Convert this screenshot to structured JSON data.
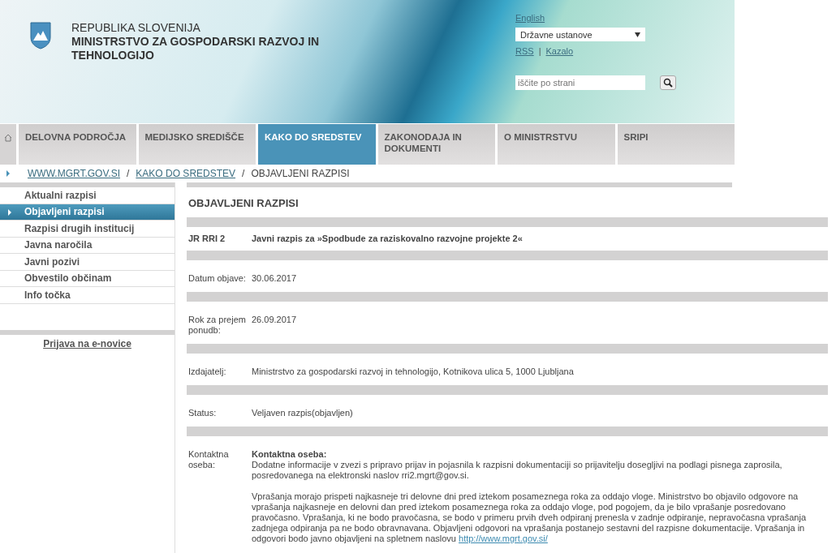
{
  "header": {
    "country": "REPUBLIKA SLOVENIJA",
    "ministry": "MINISTRSTVO ZA GOSPODARSKI RAZVOJ IN TEHNOLOGIJO",
    "language_link": "English",
    "institutions_select": "Državne ustanove",
    "links": [
      {
        "kind": "link",
        "label": "RSS"
      },
      {
        "kind": "separator",
        "label": "|"
      },
      {
        "kind": "link",
        "label": "Kazalo"
      }
    ],
    "search": {
      "placeholder": "iščite po strani"
    }
  },
  "nav": [
    {
      "label": "DELOVNA PODROČJA",
      "selected": false
    },
    {
      "label": "MEDIJSKO SREDIŠČE",
      "selected": false
    },
    {
      "label": "KAKO DO SREDSTEV",
      "selected": true
    },
    {
      "label": "ZAKONODAJA IN DOKUMENTI",
      "selected": false
    },
    {
      "label": "O MINISTRSTVU",
      "selected": false
    },
    {
      "label": "SRIPI",
      "selected": false
    }
  ],
  "breadcrumb": [
    {
      "kind": "link",
      "label": "WWW.MGRT.GOV.SI"
    },
    {
      "kind": "separator",
      "label": "/"
    },
    {
      "kind": "link",
      "label": "KAKO DO SREDSTEV"
    },
    {
      "kind": "separator",
      "label": "/"
    },
    {
      "kind": "current",
      "label": "OBJAVLJENI RAZPISI"
    }
  ],
  "sidebar": {
    "items": [
      {
        "label": "Aktualni razpisi",
        "selected": false
      },
      {
        "label": "Objavljeni razpisi",
        "selected": true
      },
      {
        "label": "Razpisi drugih institucij",
        "selected": false
      },
      {
        "label": "Javna naročila",
        "selected": false
      },
      {
        "label": "Javni pozivi",
        "selected": false
      },
      {
        "label": "Obvestilo občinam",
        "selected": false
      },
      {
        "label": "Info točka",
        "selected": false
      }
    ],
    "newsletter_link": "Prijava na e-novice"
  },
  "content": {
    "title": "OBJAVLJENI RAZPISI",
    "rows": [
      {
        "kind": "title",
        "label": "JR RRI 2",
        "value": "Javni razpis za »Spodbude za raziskovalno razvojne projekte 2«"
      },
      {
        "kind": "field",
        "label": "Datum objave:",
        "value": "30.06.2017"
      },
      {
        "kind": "field",
        "label": "Rok za prejem ponudb:",
        "value": "26.09.2017"
      },
      {
        "kind": "field",
        "label": "Izdajatelj:",
        "value": "Ministrstvo za gospodarski razvoj in tehnologijo, Kotnikova ulica 5, 1000 Ljubljana"
      },
      {
        "kind": "field",
        "label": "Status:",
        "value": "Veljaven razpis(objavljen)"
      }
    ],
    "contact": {
      "label": "Kontaktna oseba:",
      "heading": "Kontaktna oseba:",
      "paragraphs": [
        "Dodatne informacije v zvezi s pripravo prijav in pojasnila k razpisni dokumentaciji so prijavitelju dosegljivi na podlagi pisnega zaprosila, posredovanega na elektronski naslov rri2.mgrt@gov.si.",
        "Vprašanja morajo prispeti najkasneje tri delovne dni pred iztekom posameznega roka za oddajo vloge. Ministrstvo bo objavilo odgovore na vprašanja najkasneje en delovni dan pred iztekom posameznega roka za oddajo vloge, pod pogojem, da je bilo vprašanje posredovano pravočasno. Vprašanja, ki ne bodo pravočasna, se bodo v primeru prvih dveh odpiranj prenesla v zadnje odpiranje, nepravočasna vprašanja zadnjega odpiranja pa ne bodo obravnavana. Objavljeni odgovori na vprašanja postanejo sestavni del razpisne dokumentacije. Vprašanja in odgovori bodo javno objavljeni na spletnem naslovu"
      ],
      "link": "http://www.mgrt.gov.si/"
    }
  }
}
